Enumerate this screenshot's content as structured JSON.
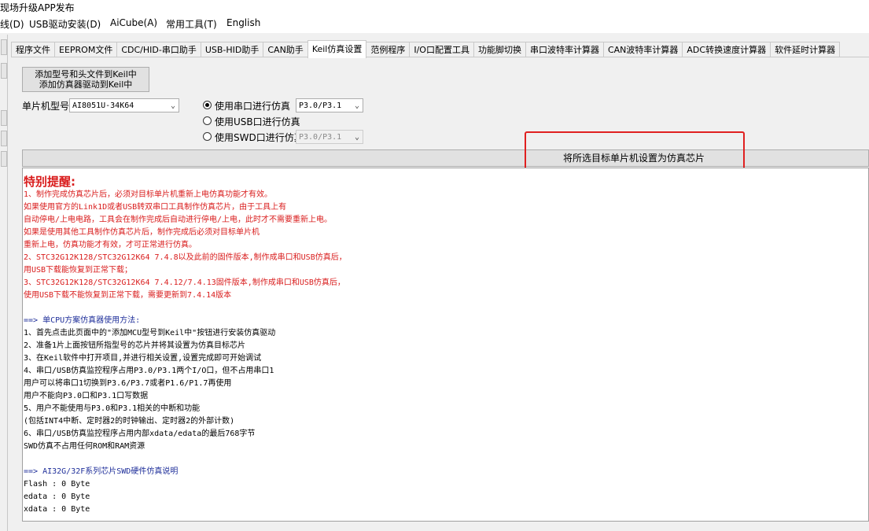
{
  "window": {
    "title": "现场升级APP发布"
  },
  "menu": [
    "线(D)",
    "USB驱动安装(D)",
    "AiCube(A)",
    "常用工具(T)",
    "English"
  ],
  "tabs": [
    "程序文件",
    "EEPROM文件",
    "CDC/HID-串口助手",
    "USB-HID助手",
    "CAN助手",
    "Keil仿真设置",
    "范例程序",
    "I/O口配置工具",
    "功能脚切换",
    "串口波特率计算器",
    "CAN波特率计算器",
    "ADC转换速度计算器",
    "软件延时计算器"
  ],
  "active_tab": "Keil仿真设置",
  "keil": {
    "add_button_line1": "添加型号和头文件到Keil中",
    "add_button_line2": "添加仿真器驱动到Keil中",
    "mcu_label": "单片机型号",
    "mcu_value": "AI8051U-34K64",
    "radio_uart": "使用串口进行仿真",
    "radio_usb": "使用USB口进行仿真",
    "radio_swd": "使用SWD口进行仿真",
    "selected_radio": "uart",
    "uart_port": "P3.0/P3.1",
    "swd_port": "P3.0/P3.1",
    "set_target_button": "将所选目标单片机设置为仿真芯片"
  },
  "notes": {
    "heading": "特别提醒:",
    "red_lines": [
      "1、制作完成仿真芯片后，必须对目标单片机重新上电仿真功能才有效。",
      "   如果使用官方的Link1D或者USB转双串口工具制作仿真芯片，由于工具上有",
      "   自动停电/上电电路，工具会在制作完成后自动进行停电/上电，此时才不需要重新上电。",
      "   如果是使用其他工具制作仿真芯片后，制作完成后必须对目标单片机",
      "   重新上电，仿真功能才有效，才可正常进行仿真。",
      "2、STC32G12K128/STC32G12K64  7.4.8以及此前的固件版本,制作成串口和USB仿真后，",
      "   用USB下载能恢复到正常下载；",
      "3、STC32G12K128/STC32G12K64  7.4.12/7.4.13固件版本,制作成串口和USB仿真后，",
      "   使用USB下载不能恢复到正常下载，需要更新到7.4.14版本"
    ],
    "cpu_heading": "==> 单CPU方案仿真器使用方法:",
    "black_lines": [
      "1、首先点击此页面中的\"添加MCU型号到Keil中\"按钮进行安装仿真驱动",
      "2、准备1片上面按钮所指型号的芯片并将其设置为仿真目标芯片",
      "3、在Keil软件中打开项目,并进行相关设置,设置完成即可开始调试",
      "4、串口/USB仿真监控程序占用P3.0/P3.1两个I/O口，但不占用串口1",
      "   用户可以将串口1切换到P3.6/P3.7或者P1.6/P1.7再使用",
      "   用户不能向P3.0口和P3.1口写数据",
      "5、用户不能使用与P3.0和P3.1相关的中断和功能",
      "   (包括INT4中断、定时器2的时钟输出、定时器2的外部计数)",
      "6、串口/USB仿真监控程序占用内部xdata/edata的最后768字节",
      "   SWD仿真不占用任何ROM和RAM资源"
    ],
    "swd_heading": "==> AI32G/32F系列芯片SWD硬件仿真说明",
    "mem_lines": [
      "Flash : 0 Byte",
      "edata : 0 Byte",
      "xdata : 0 Byte"
    ]
  }
}
